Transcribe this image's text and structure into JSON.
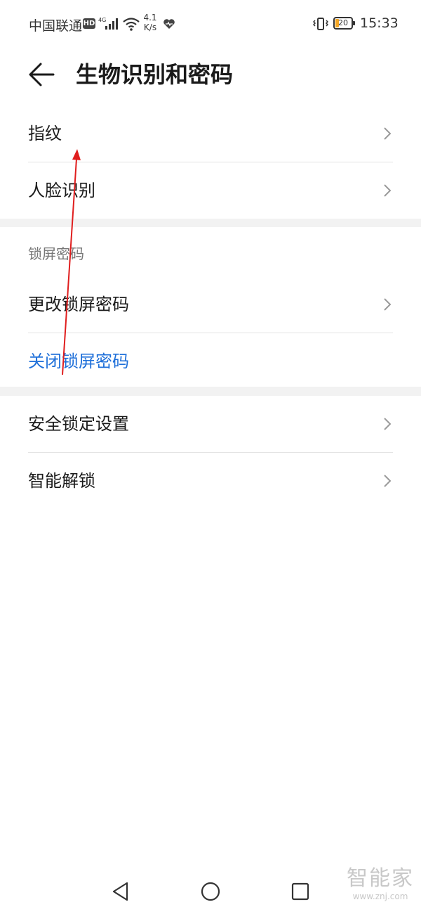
{
  "status_bar": {
    "carrier": "中国联通",
    "hd_badge": "HD",
    "network": "4G",
    "speed_value": "4.1",
    "speed_unit": "K/s",
    "battery_level": "20",
    "time": "15:33"
  },
  "header": {
    "title": "生物识别和密码"
  },
  "biometrics": {
    "items": [
      {
        "label": "指纹"
      },
      {
        "label": "人脸识别"
      }
    ]
  },
  "lock_screen": {
    "section_title": "锁屏密码",
    "change_label": "更改锁屏密码",
    "disable_label": "关闭锁屏密码"
  },
  "other": {
    "items": [
      {
        "label": "安全锁定设置"
      },
      {
        "label": "智能解锁"
      }
    ]
  },
  "watermark": {
    "brand": "智能家",
    "url": "www.znj.com"
  },
  "colors": {
    "accent_blue": "#1e6fd9",
    "annotation_red": "#e01e1e",
    "section_gap": "#f2f2f2"
  }
}
